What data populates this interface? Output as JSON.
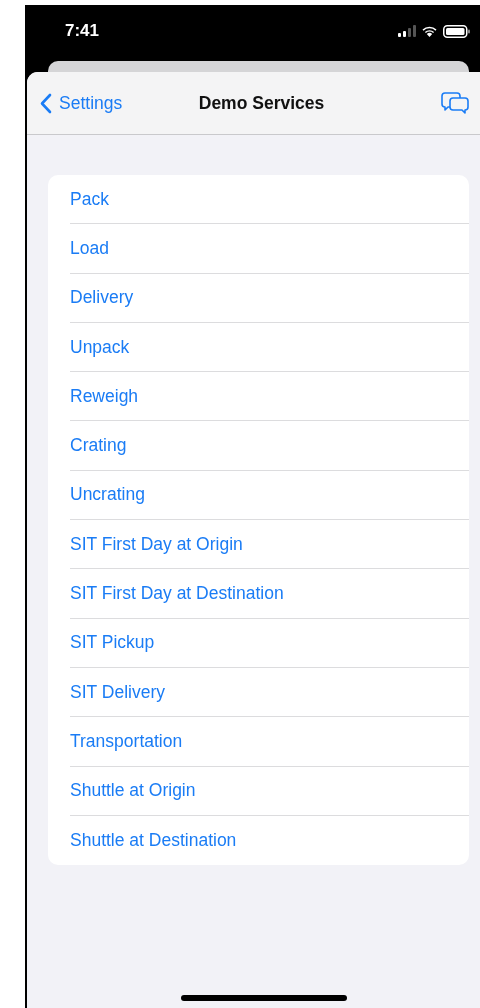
{
  "status_bar": {
    "time": "7:41"
  },
  "nav": {
    "back_label": "Settings",
    "title": "Demo Services"
  },
  "items": [
    {
      "label": "Pack"
    },
    {
      "label": "Load"
    },
    {
      "label": "Delivery"
    },
    {
      "label": "Unpack"
    },
    {
      "label": "Reweigh"
    },
    {
      "label": "Crating"
    },
    {
      "label": "Uncrating"
    },
    {
      "label": "SIT First Day at Origin"
    },
    {
      "label": "SIT First Day at Destination"
    },
    {
      "label": "SIT Pickup"
    },
    {
      "label": "SIT Delivery"
    },
    {
      "label": "Transportation"
    },
    {
      "label": "Shuttle at Origin"
    },
    {
      "label": "Shuttle at Destination"
    }
  ]
}
